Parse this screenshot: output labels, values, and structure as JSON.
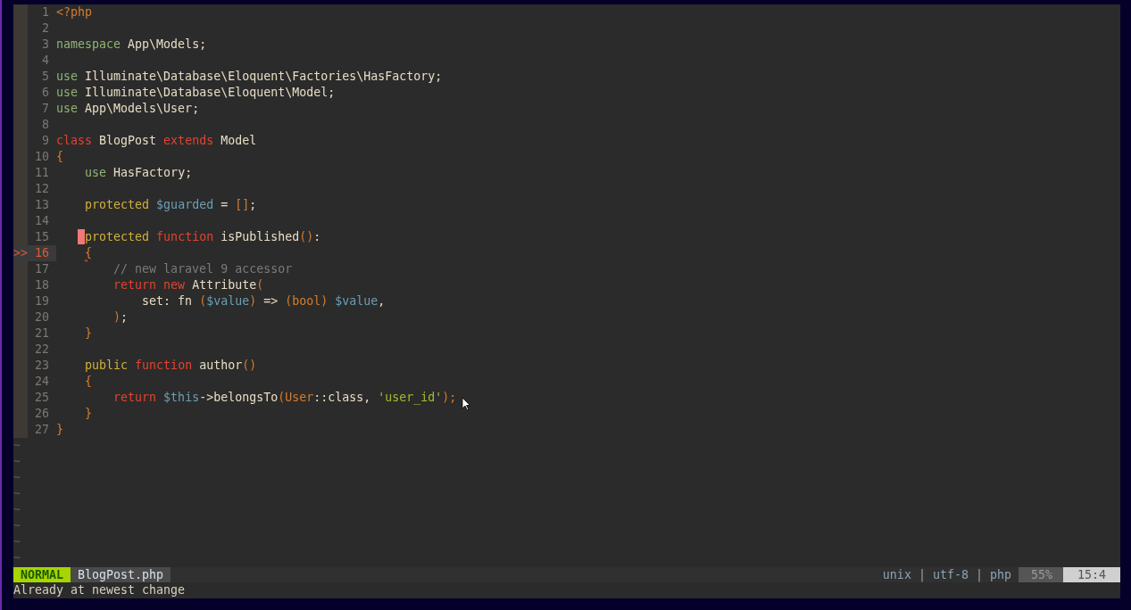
{
  "editor": {
    "lines": [
      {
        "number": "1",
        "current": false,
        "cursor": false,
        "tokens": [
          {
            "text": "<?php",
            "kind": "punct"
          }
        ]
      },
      {
        "number": "2",
        "current": false,
        "cursor": false
      },
      {
        "number": "3",
        "current": false,
        "cursor": false,
        "tokens": [
          {
            "text": "namespace",
            "kind": "include"
          },
          {
            "text": " App\\Models;",
            "kind": "plain"
          }
        ]
      },
      {
        "number": "4",
        "current": false,
        "cursor": false
      },
      {
        "number": "5",
        "current": false,
        "cursor": false,
        "tokens": [
          {
            "text": "use",
            "kind": "include"
          },
          {
            "text": " Illuminate\\Database\\Eloquent\\Factories\\HasFactory;",
            "kind": "plain"
          }
        ]
      },
      {
        "number": "6",
        "current": false,
        "cursor": false,
        "tokens": [
          {
            "text": "use",
            "kind": "include"
          },
          {
            "text": " Illuminate\\Database\\Eloquent\\Model;",
            "kind": "plain"
          }
        ]
      },
      {
        "number": "7",
        "current": false,
        "cursor": false,
        "tokens": [
          {
            "text": "use",
            "kind": "include"
          },
          {
            "text": " App\\Models\\User;",
            "kind": "plain"
          }
        ]
      },
      {
        "number": "8",
        "current": false,
        "cursor": false
      },
      {
        "number": "9",
        "current": false,
        "cursor": false,
        "tokens": [
          {
            "text": "class",
            "kind": "keyword"
          },
          {
            "text": " BlogPost ",
            "kind": "plain"
          },
          {
            "text": "extends",
            "kind": "keyword"
          },
          {
            "text": " Model",
            "kind": "plain"
          }
        ]
      },
      {
        "number": "10",
        "current": false,
        "cursor": false,
        "tokens": [
          {
            "text": "{",
            "kind": "punct"
          }
        ]
      },
      {
        "number": "11",
        "current": false,
        "cursor": false,
        "tokens": [
          {
            "text": "    use",
            "kind": "include"
          },
          {
            "text": " HasFactory;",
            "kind": "plain"
          }
        ]
      },
      {
        "number": "12",
        "current": false,
        "cursor": false
      },
      {
        "number": "13",
        "current": false,
        "cursor": false,
        "tokens": [
          {
            "text": "    protected",
            "kind": "storage"
          },
          {
            "text": " $guarded",
            "kind": "variable"
          },
          {
            "text": " = ",
            "kind": "plain"
          },
          {
            "text": "[]",
            "kind": "punct"
          },
          {
            "text": ";",
            "kind": "plain"
          }
        ]
      },
      {
        "number": "14",
        "current": false,
        "cursor": false
      },
      {
        "number": "15",
        "current": false,
        "cursor": true,
        "tokens": [
          {
            "text": "    protected",
            "kind": "storage"
          },
          {
            "text": " function",
            "kind": "keyword"
          },
          {
            "text": " isPublished",
            "kind": "plain"
          },
          {
            "text": "()",
            "kind": "punct"
          },
          {
            "text": ":",
            "kind": "plain"
          }
        ]
      },
      {
        "number": "16",
        "current": true,
        "cursor": false,
        "sign": ">>",
        "tokens": [
          {
            "text": "    {",
            "kind": "error"
          }
        ]
      },
      {
        "number": "17",
        "current": false,
        "cursor": false,
        "tokens": [
          {
            "text": "        // new laravel 9 accessor",
            "kind": "comment"
          }
        ]
      },
      {
        "number": "18",
        "current": false,
        "cursor": false,
        "tokens": [
          {
            "text": "        return",
            "kind": "keyword"
          },
          {
            "text": " new",
            "kind": "keyword"
          },
          {
            "text": " Attribute",
            "kind": "plain"
          },
          {
            "text": "(",
            "kind": "punct"
          }
        ]
      },
      {
        "number": "19",
        "current": false,
        "cursor": false,
        "tokens": [
          {
            "text": "            set: fn ",
            "kind": "plain"
          },
          {
            "text": "(",
            "kind": "punct"
          },
          {
            "text": "$value",
            "kind": "variable"
          },
          {
            "text": ")",
            "kind": "punct"
          },
          {
            "text": " => ",
            "kind": "plain"
          },
          {
            "text": "(bool)",
            "kind": "punct"
          },
          {
            "text": " $value",
            "kind": "variable"
          },
          {
            "text": ",",
            "kind": "plain"
          }
        ]
      },
      {
        "number": "20",
        "current": false,
        "cursor": false,
        "tokens": [
          {
            "text": "        )",
            "kind": "punct"
          },
          {
            "text": ";",
            "kind": "plain"
          }
        ]
      },
      {
        "number": "21",
        "current": false,
        "cursor": false,
        "tokens": [
          {
            "text": "    }",
            "kind": "punct"
          }
        ]
      },
      {
        "number": "22",
        "current": false,
        "cursor": false
      },
      {
        "number": "23",
        "current": false,
        "cursor": false,
        "tokens": [
          {
            "text": "    public",
            "kind": "storage"
          },
          {
            "text": " function",
            "kind": "keyword"
          },
          {
            "text": " author",
            "kind": "plain"
          },
          {
            "text": "()",
            "kind": "punct"
          }
        ]
      },
      {
        "number": "24",
        "current": false,
        "cursor": false,
        "tokens": [
          {
            "text": "    {",
            "kind": "punct"
          }
        ]
      },
      {
        "number": "25",
        "current": false,
        "cursor": false,
        "tokens": [
          {
            "text": "        return",
            "kind": "keyword"
          },
          {
            "text": " $this",
            "kind": "variable"
          },
          {
            "text": "->belongsTo",
            "kind": "plain"
          },
          {
            "text": "(User",
            "kind": "punct"
          },
          {
            "text": "::class, ",
            "kind": "plain"
          },
          {
            "text": "'user_id'",
            "kind": "string"
          },
          {
            "text": ");",
            "kind": "punct"
          }
        ]
      },
      {
        "number": "26",
        "current": false,
        "cursor": false,
        "tokens": [
          {
            "text": "    }",
            "kind": "punct"
          }
        ]
      },
      {
        "number": "27",
        "current": false,
        "cursor": false,
        "tokens": [
          {
            "text": "}",
            "kind": "punct"
          }
        ]
      }
    ],
    "filler_lines": [
      "~",
      "~",
      "~",
      "~",
      "~",
      "~",
      "~",
      "~"
    ]
  },
  "status_line": {
    "mode": "NORMAL",
    "file": "BlogPost.php",
    "file_info": "unix | utf-8 | php",
    "percent": "55%",
    "position": "15:4"
  },
  "message": "Already at newest change"
}
